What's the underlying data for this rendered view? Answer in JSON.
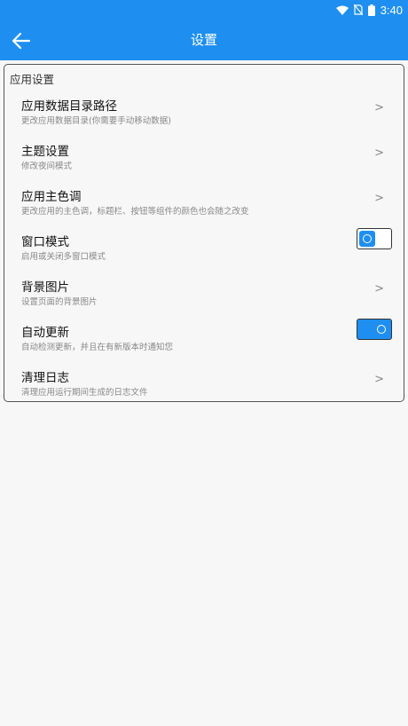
{
  "status_bar": {
    "time": "3:40"
  },
  "app_bar": {
    "title": "设置"
  },
  "section": {
    "title": "应用设置"
  },
  "settings": [
    {
      "label": "应用数据目录路径",
      "desc": "更改应用数据目录(你需要手动移动数据)",
      "control": ">"
    },
    {
      "label": "主题设置",
      "desc": "修改夜间模式",
      "control": ">"
    },
    {
      "label": "应用主色调",
      "desc": "更改应用的主色调，标题栏、按钮等组件的颜色也会随之改变",
      "control": ">"
    },
    {
      "label": "窗口模式",
      "desc": "启用或关闭多窗口模式",
      "control": "toggle",
      "enabled": false
    },
    {
      "label": "背景图片",
      "desc": "设置页面的背景图片",
      "control": ">"
    },
    {
      "label": "自动更新",
      "desc": "自动检测更新，并且在有新版本时通知您",
      "control": "toggle",
      "enabled": true
    },
    {
      "label": "清理日志",
      "desc": "清理应用运行期间生成的日志文件",
      "control": ">"
    }
  ],
  "colors": {
    "accent": "#1e8ff0",
    "background": "#f7f7f7"
  },
  "icons": [
    "wifi-icon",
    "no-sim-icon",
    "battery-icon",
    "back-arrow-icon"
  ]
}
